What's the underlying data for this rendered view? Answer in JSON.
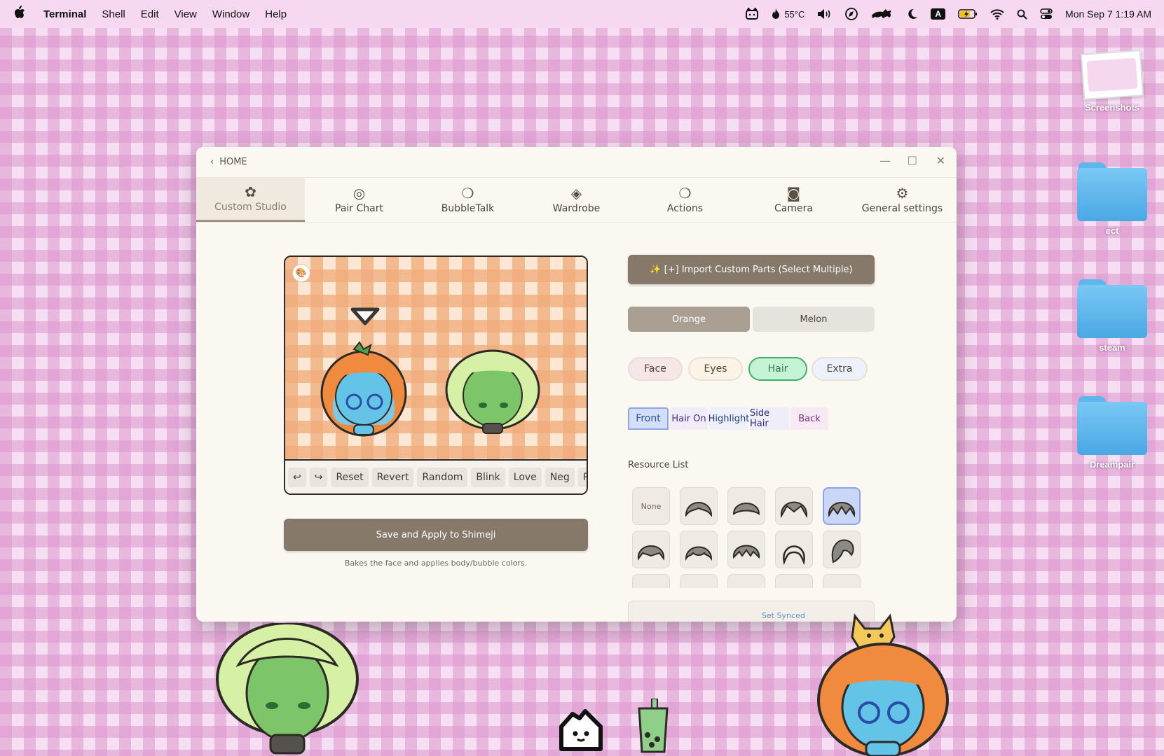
{
  "menubar": {
    "app": "Terminal",
    "items": [
      "Shell",
      "Edit",
      "View",
      "Window",
      "Help"
    ],
    "temperature": "55°C",
    "input_source": "A",
    "datetime": "Mon Sep 7  1:19 AM"
  },
  "desktop": {
    "icons": [
      "Screenshots",
      "ect",
      "steam",
      "Dreampair"
    ]
  },
  "window": {
    "back_label": "HOME",
    "tabs": [
      "Custom Studio",
      "Pair Chart",
      "BubbleTalk",
      "Wardrobe",
      "Actions",
      "Camera",
      "General settings"
    ],
    "active_tab": "Custom Studio",
    "preview_tools": [
      "Reset",
      "Revert",
      "Random",
      "Blink",
      "Love",
      "Neg",
      "Pos"
    ],
    "save_label": "Save and Apply to Shimeji",
    "save_hint": "Bakes the face and applies body/bubble colors.",
    "import_label": "✨ [+] Import Custom Parts (Select Multiple)",
    "pair": [
      "Orange",
      "Melon"
    ],
    "categories": [
      "Face",
      "Eyes",
      "Hair",
      "Extra"
    ],
    "subtabs": [
      "Front",
      "Hair On",
      "Highlight",
      "Side Hair",
      "Back"
    ],
    "resource_label": "Resource List",
    "resource_none": "None",
    "synced_label": "Set Synced"
  },
  "colors": {
    "accent_brown": "#86796a",
    "hair_active": "#3fb06a",
    "selected_resource": "#c9d6f5"
  }
}
